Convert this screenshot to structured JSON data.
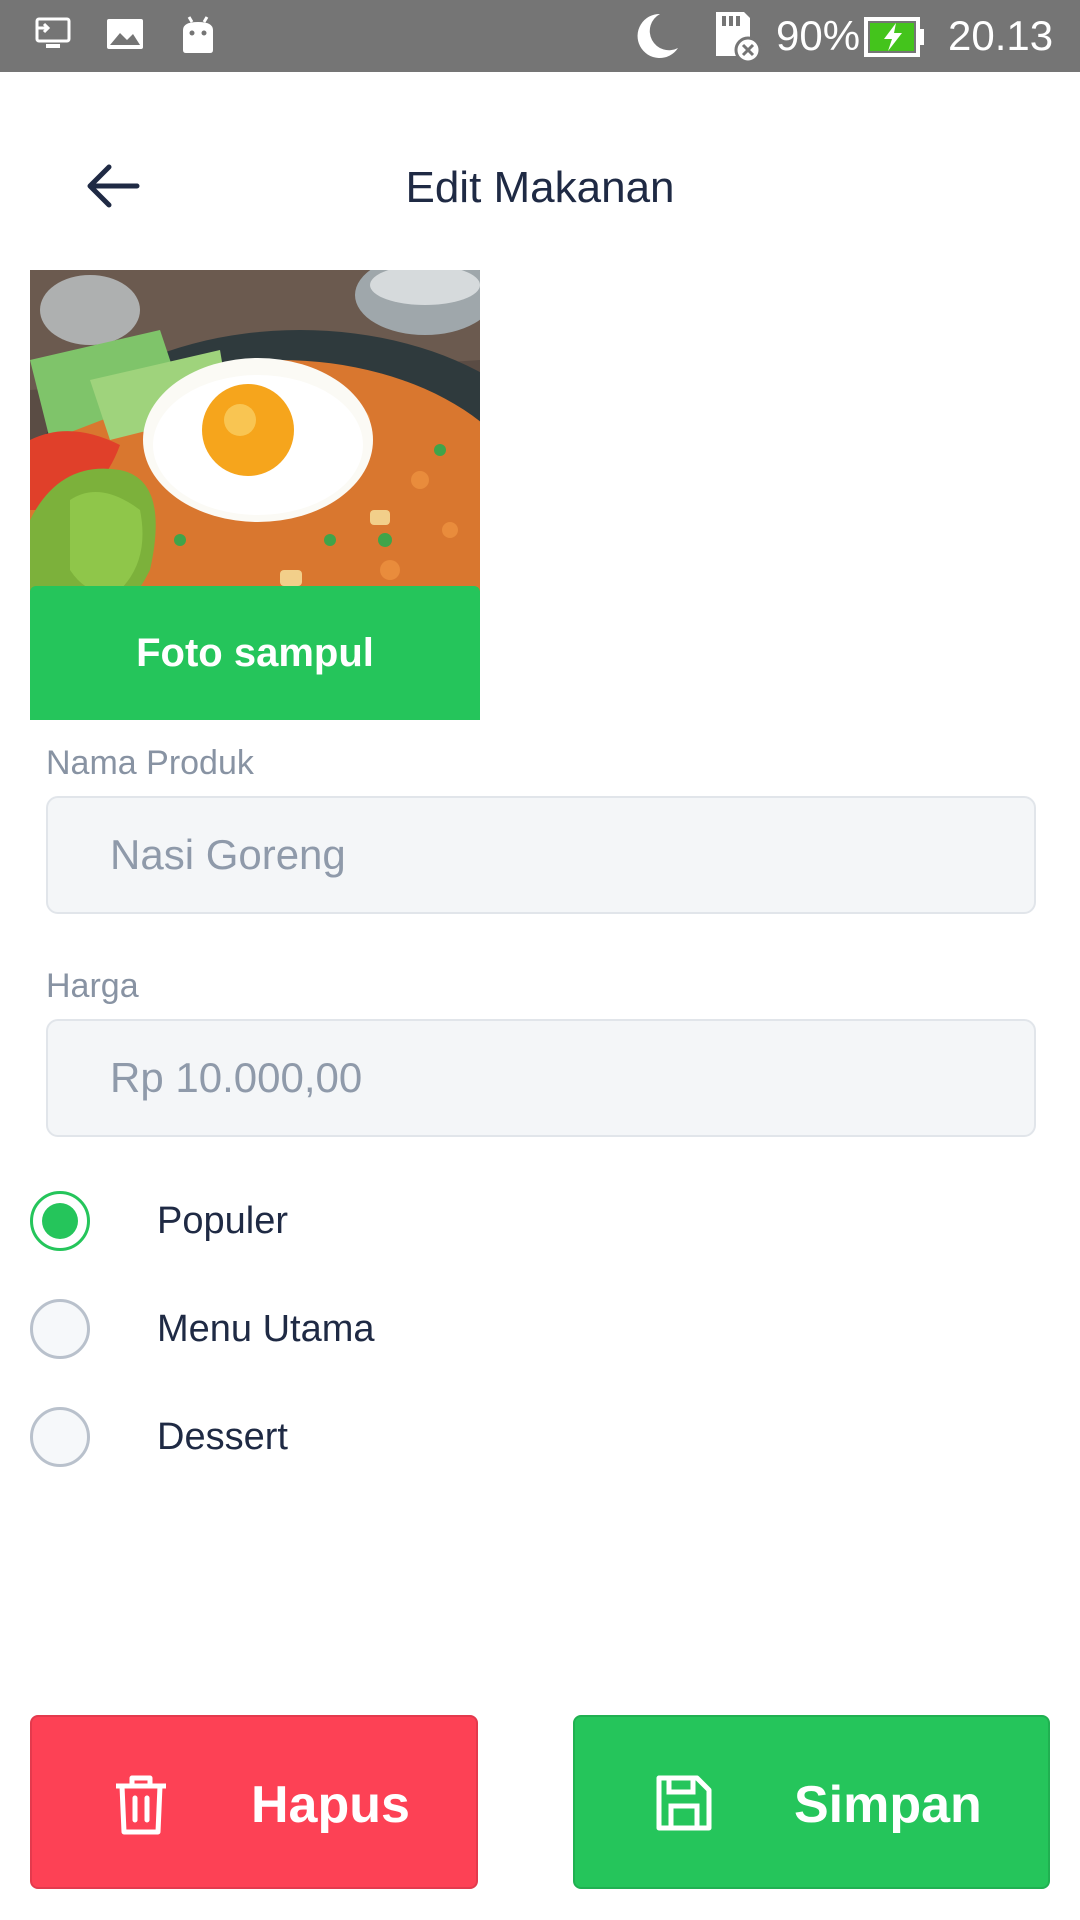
{
  "status_bar": {
    "battery_percent": "90%",
    "time": "20.13",
    "icons": [
      "screen-cast-icon",
      "image-icon",
      "android-icon",
      "moon-icon",
      "sd-card-error-icon",
      "battery-charging-icon"
    ]
  },
  "header": {
    "title": "Edit Makanan",
    "back_icon": "arrow-left-icon"
  },
  "cover": {
    "button_label": "Foto sampul"
  },
  "form": {
    "product_name": {
      "label": "Nama Produk",
      "value": "Nasi Goreng"
    },
    "price": {
      "label": "Harga",
      "value": "Rp 10.000,00"
    }
  },
  "categories": {
    "selected": "Populer",
    "options": [
      "Populer",
      "Menu Utama",
      "Dessert"
    ]
  },
  "actions": {
    "delete_label": "Hapus",
    "delete_icon": "trash-icon",
    "save_label": "Simpan",
    "save_icon": "floppy-disk-icon"
  },
  "colors": {
    "accent_green": "#25c55b",
    "danger_red": "#fd4155",
    "status_bar": "#757575",
    "text_dark": "#1f2a44",
    "text_muted": "#8893a3"
  }
}
